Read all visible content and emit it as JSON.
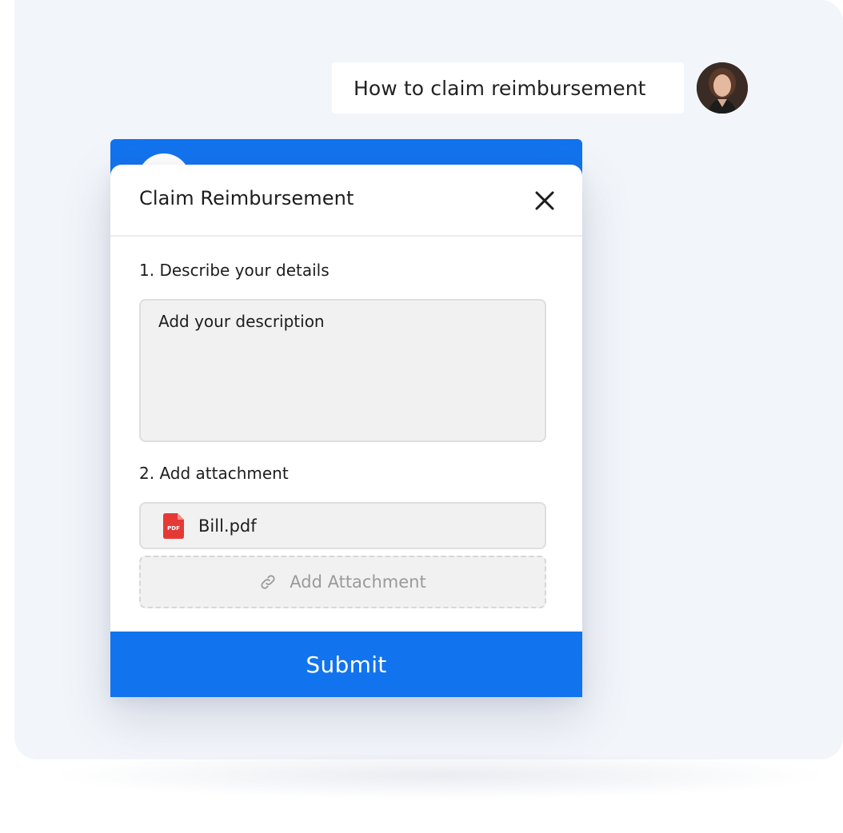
{
  "chat": {
    "user_message": "How to claim reimbursement"
  },
  "modal": {
    "title": "Claim Reimbursement",
    "close_icon": "close-icon",
    "step1_label": "1. Describe your details",
    "description_placeholder": "Add your description",
    "step2_label": "2. Add attachment",
    "attachment": {
      "file_name": "Bill.pdf",
      "file_icon": "pdf-file-icon",
      "file_icon_text": "PDF"
    },
    "add_attachment_label": "Add Attachment",
    "add_attachment_icon": "link-icon",
    "submit_label": "Submit"
  },
  "colors": {
    "accent": "#1273ee",
    "background": "#f2f5fa",
    "input_bg": "#f1f1f1",
    "pdf_red": "#e53935"
  }
}
